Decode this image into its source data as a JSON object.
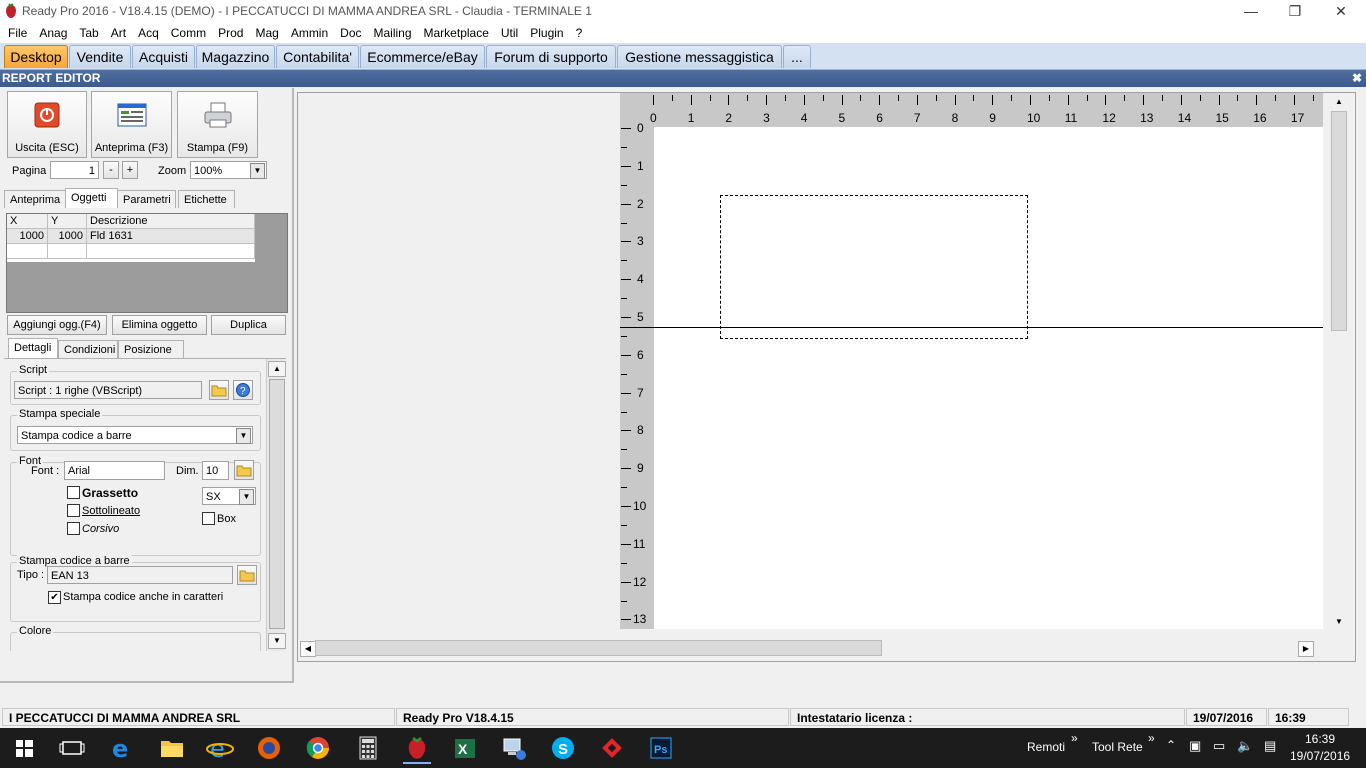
{
  "window": {
    "title": "Ready Pro 2016 - V18.4.15 (DEMO)  - I PECCATUCCI DI MAMMA ANDREA SRL - Claudia - TERMINALE 1"
  },
  "menu": [
    "File",
    "Anag",
    "Tab",
    "Art",
    "Acq",
    "Comm",
    "Prod",
    "Mag",
    "Ammin",
    "Doc",
    "Mailing",
    "Marketplace",
    "Util",
    "Plugin",
    "?"
  ],
  "tabs": [
    "Desktop",
    "Vendite",
    "Acquisti",
    "Magazzino",
    "Contabilita'",
    "Ecommerce/eBay",
    "Forum di supporto",
    "Gestione messaggistica",
    "..."
  ],
  "report_editor": {
    "header": "REPORT EDITOR",
    "buttons": {
      "exit": "Uscita (ESC)",
      "preview": "Anteprima (F3)",
      "print": "Stampa (F9)"
    },
    "page_label": "Pagina",
    "page_value": "1",
    "minus": "-",
    "plus": "+",
    "zoom_label": "Zoom",
    "zoom_value": "100%",
    "tabs": [
      "Anteprima",
      "Oggetti",
      "Parametri",
      "Etichette"
    ],
    "table": {
      "headers": [
        "X",
        "Y",
        "Descrizione"
      ],
      "rows": [
        [
          "1000",
          "1000",
          "Fld 1631"
        ]
      ]
    },
    "obj_buttons": {
      "add": "Aggiungi ogg.(F4)",
      "delete": "Elimina oggetto",
      "duplicate": "Duplica"
    },
    "detail_tabs": [
      "Dettagli",
      "Condizioni",
      "Posizione"
    ],
    "script": {
      "group": "Script",
      "value": "Script : 1 righe (VBScript)"
    },
    "special_print": {
      "group": "Stampa speciale",
      "value": "Stampa codice a barre"
    },
    "font": {
      "group": "Font",
      "font_label": "Font :",
      "font_value": "Arial",
      "dim_label": "Dim.",
      "dim_value": "10",
      "bold": "Grassetto",
      "underline": "Sottolineato",
      "italic": "Corsivo",
      "align_value": "SX",
      "box": "Box"
    },
    "barcode": {
      "group": "Stampa codice a barre",
      "type_label": "Tipo :",
      "type_value": "EAN 13",
      "print_chars": "Stampa codice anche in caratteri",
      "print_chars_checked": true
    },
    "color": {
      "group": "Colore"
    }
  },
  "ruler": {
    "h": [
      "0",
      "1",
      "2",
      "3",
      "4",
      "5",
      "6",
      "7",
      "8",
      "9",
      "10",
      "11",
      "12",
      "13",
      "14",
      "15",
      "16",
      "17"
    ],
    "v": [
      "0",
      "1",
      "2",
      "3",
      "4",
      "5",
      "6",
      "7",
      "8",
      "9",
      "10",
      "11",
      "12",
      "13"
    ]
  },
  "status": {
    "company": "I PECCATUCCI DI MAMMA ANDREA SRL",
    "version": "Ready Pro V18.4.15",
    "license": "Intestatario licenza :",
    "date": "19/07/2016",
    "time": "16:39"
  },
  "taskbar": {
    "remoti": "Remoti",
    "tool_rete": "Tool Rete",
    "clock_time": "16:39",
    "clock_date": "19/07/2016"
  }
}
